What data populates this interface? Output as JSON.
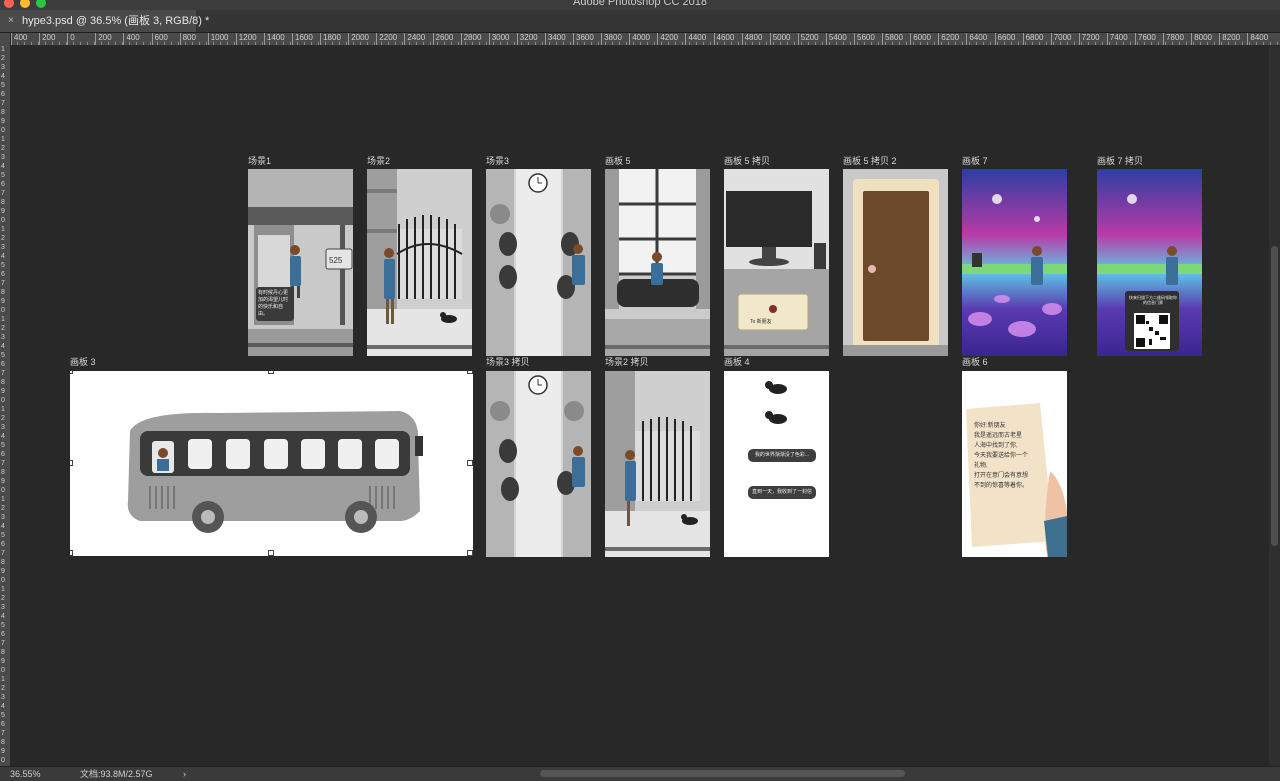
{
  "window": {
    "title": "Adobe Photoshop CC 2018"
  },
  "colors": {
    "canvas_bg": "#282828",
    "panel": "#3c3c3c",
    "ruler": "#4a4a4a",
    "close": "#ff5f57",
    "minimize": "#febc2e",
    "zoom": "#28c840"
  },
  "tab": {
    "close_glyph": "×",
    "label": "hype3.psd @ 36.5% (画板 3, RGB/8) *"
  },
  "ruler": {
    "h_ticks": [
      "400",
      "200",
      "0",
      "200",
      "400",
      "600",
      "800",
      "1000",
      "1200",
      "1400",
      "1600",
      "1800",
      "2000",
      "2200",
      "2400",
      "2600",
      "2800",
      "3000",
      "3200",
      "3400",
      "3600",
      "3800",
      "4000",
      "4200",
      "4400",
      "4600",
      "4800",
      "5000",
      "5200",
      "5400",
      "5600",
      "5800",
      "6000",
      "6200",
      "6400",
      "6600",
      "6800",
      "7000",
      "7200",
      "7400",
      "7600",
      "7800",
      "8000",
      "8200",
      "8400"
    ]
  },
  "artboards": {
    "scene1": {
      "label": "场景1",
      "caption": "有时候丹心更加的渴望儿时的快乐和自由。",
      "sign": "525"
    },
    "scene2": {
      "label": "场景2"
    },
    "scene3": {
      "label": "场景3"
    },
    "board5": {
      "label": "画板 5"
    },
    "board5copy": {
      "label": "画板 5 拷贝",
      "card": "To 新朋友"
    },
    "board5copy2": {
      "label": "画板 5 拷贝 2"
    },
    "board7": {
      "label": "画板 7"
    },
    "board7copy": {
      "label": "画板 7 拷贝",
      "qr_text": "快来扫描下方二维码领取你的信息门票"
    },
    "board3": {
      "label": "画板 3"
    },
    "scene3copy": {
      "label": "场景3 拷贝"
    },
    "scene2copy": {
      "label": "场景2 拷贝"
    },
    "board4": {
      "label": "画板 4",
      "bubble1": "我的世界渐渐没了色彩...",
      "bubble2": "直到一天，我收到了一封信"
    },
    "board6": {
      "label": "画板 6",
      "letter": [
        "你好:新朋友",
        "我是遥远而古老星",
        "人海中找到了你,",
        "今天我要送给你一个",
        "礼物,",
        "打开在意门会有意想",
        "不到的惊喜等着你。"
      ]
    }
  },
  "status": {
    "zoom": "36.55%",
    "doc": "文档:93.8M/2.57G",
    "arrow": "›"
  }
}
